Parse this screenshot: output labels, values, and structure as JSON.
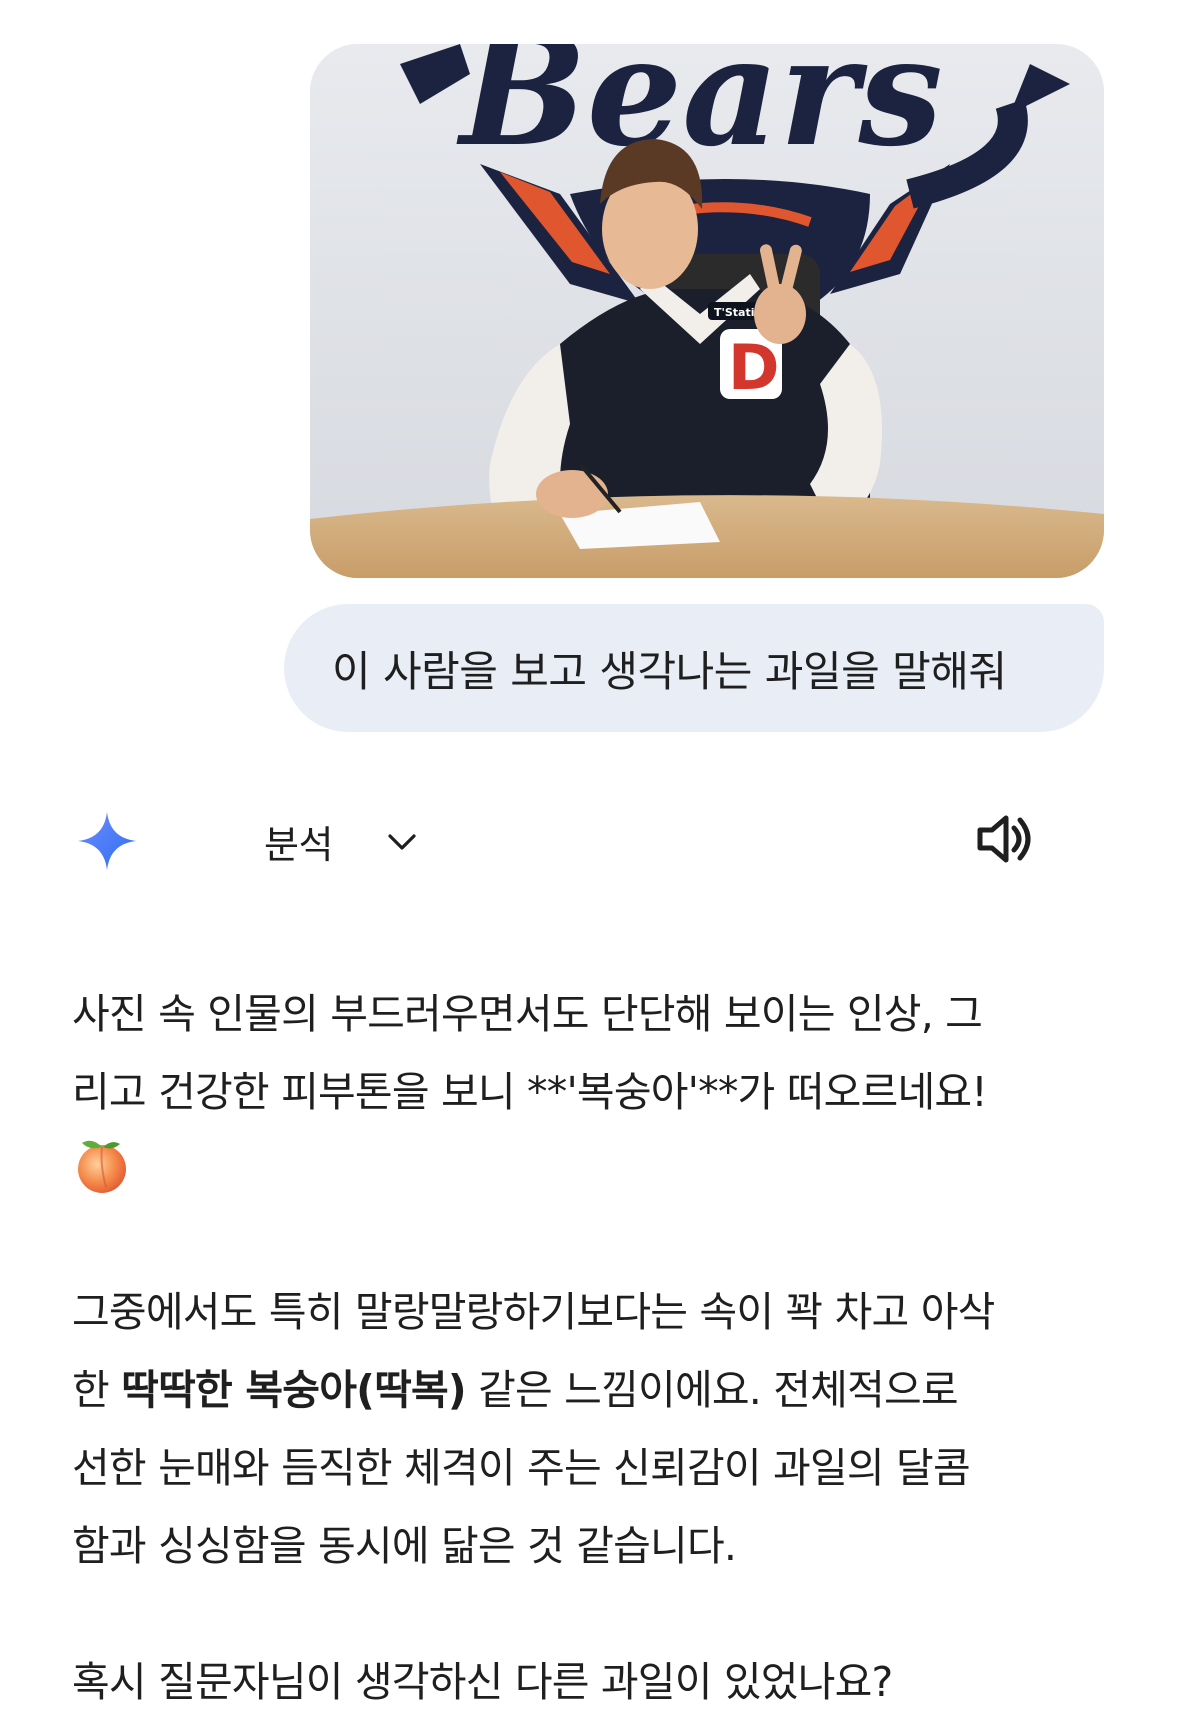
{
  "attachment": {
    "logo_text": "Bears",
    "sponsor_patch": "T'Station",
    "jacket_letter": "D"
  },
  "prompt": {
    "text": "이 사람을 보고 생각나는 과일을 말해줘"
  },
  "response_header": {
    "mode_label": "분석",
    "icons": [
      "gemini-spark-icon",
      "chevron-down-icon",
      "speaker-icon"
    ],
    "accent_color": "#4b7bf5"
  },
  "response": {
    "p1_line1": "사진 속 인물의 부드러우면서도 단단해 보이는 인상, 그",
    "p1_line2": "리고 건강한 피부톤을 보니 **'복숭아'**가 떠오르네요!",
    "p1_emoji": "peach-icon",
    "p2_line1": "그중에서도 특히 말랑말랑하기보다는 속이 꽉 차고 아삭",
    "p2_line2_pre": "한 ",
    "p2_line2_bold": "딱딱한 복숭아(딱복)",
    "p2_line2_post": " 같은 느낌이에요. 전체적으로",
    "p2_line3": "선한 눈매와 듬직한 체격이 주는 신뢰감이 과일의 달콤",
    "p2_line4": "함과 싱싱함을 동시에 닮은 것 같습니다.",
    "p3": "혹시 질문자님이 생각하신 다른 과일이 있었나요?"
  }
}
